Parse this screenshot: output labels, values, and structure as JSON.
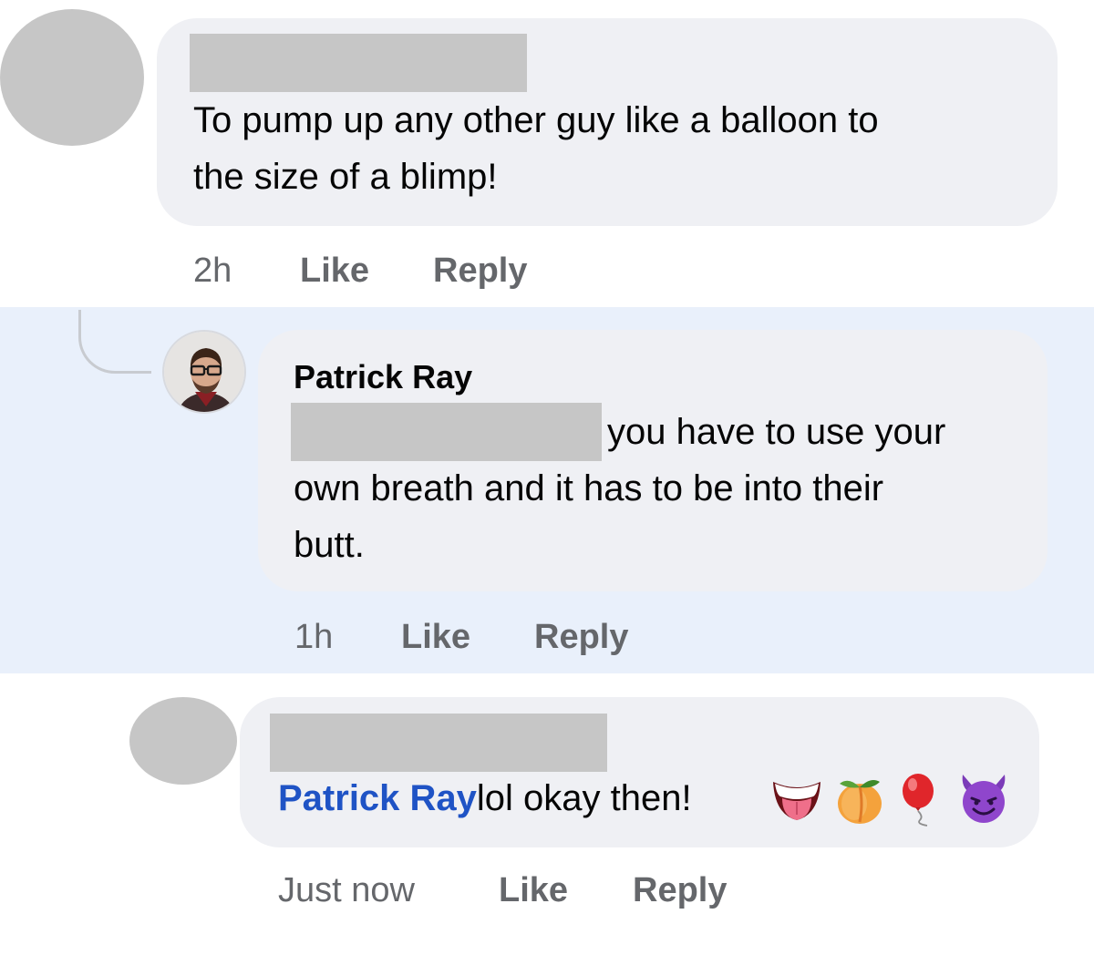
{
  "comments": [
    {
      "text_lines": [
        "To pump up any other guy like a balloon to",
        "the size of a blimp!"
      ],
      "time": "2h",
      "like_label": "Like",
      "reply_label": "Reply"
    },
    {
      "author": "Patrick Ray",
      "text_line1": "you have to use your",
      "text_line2": "own breath and it has to be into their",
      "text_line3": "butt.",
      "time": "1h",
      "like_label": "Like",
      "reply_label": "Reply"
    },
    {
      "mention": "Patrick Ray",
      "text": "lol okay then!",
      "emojis": [
        "tongue-icon",
        "peach-icon",
        "balloon-icon",
        "smiling-devil-icon"
      ],
      "time": "Just now",
      "like_label": "Like",
      "reply_label": "Reply"
    }
  ],
  "colors": {
    "bubble": "#eff0f4",
    "highlight": "#e9f0fb",
    "mention": "#1f53c5",
    "meta": "#65676b",
    "redaction": "#c6c6c6"
  }
}
